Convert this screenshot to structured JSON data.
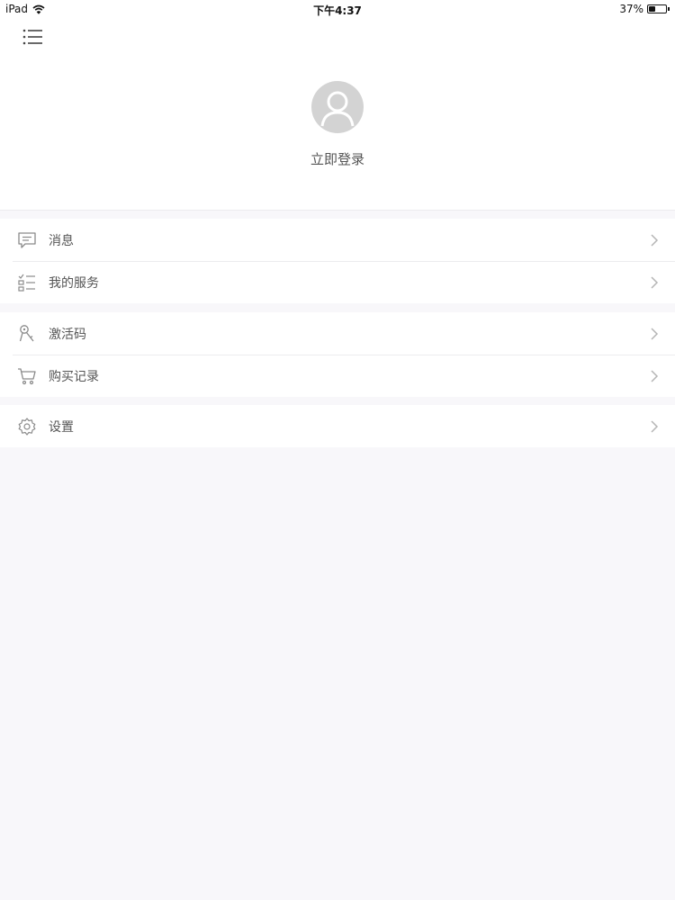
{
  "status_bar": {
    "device": "iPad",
    "time": "下午4:37",
    "battery": "37%",
    "battery_level": 0.37
  },
  "header": {
    "menu_icon": "hamburger-menu-icon",
    "avatar_icon": "user-avatar-icon",
    "login_label": "立即登录"
  },
  "menu": {
    "messages": {
      "label": "消息",
      "icon": "chat-bubble-icon"
    },
    "services": {
      "label": "我的服务",
      "icon": "checklist-icon"
    },
    "activation": {
      "label": "激活码",
      "icon": "key-icon"
    },
    "purchases": {
      "label": "购买记录",
      "icon": "cart-icon"
    },
    "settings": {
      "label": "设置",
      "icon": "gear-icon"
    }
  },
  "colors": {
    "background": "#f8f7fa",
    "card": "#ffffff",
    "text": "#555555",
    "icon": "#8a8a8a",
    "avatar": "#d3d3d3"
  }
}
